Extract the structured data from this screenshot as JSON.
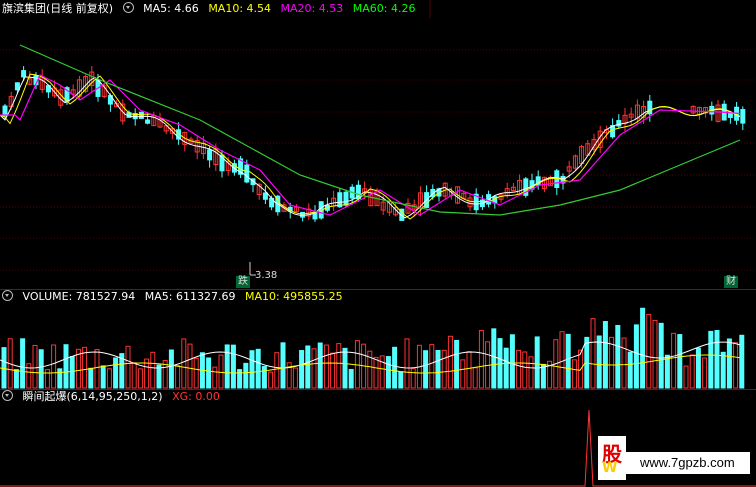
{
  "price_header": {
    "stock": "旗滨集团(日线 前复权)",
    "ma5": "MA5: 4.66",
    "ma10": "MA10: 4.54",
    "ma20": "MA20: 4.53",
    "ma60": "MA60: 4.26",
    "colors": {
      "stock": "#ffffff",
      "ma5": "#ffffff",
      "ma10": "#ffff00",
      "ma20": "#ff00ff",
      "ma60": "#00ff00"
    }
  },
  "price_low_label": "3.38",
  "tags": {
    "left": "跌",
    "right": "财"
  },
  "volume_header": {
    "volume": "VOLUME: 781527.94",
    "ma5": "MA5: 611327.69",
    "ma10": "MA10: 495855.25",
    "colors": {
      "volume": "#ffffff",
      "ma5": "#ffffff",
      "ma10": "#ffff00"
    }
  },
  "indicator_header": {
    "name": "瞬间起爆(6,14,95,250,1,2)",
    "xg": "XG: 0.00",
    "colors": {
      "name": "#ffffff",
      "xg": "#ff3333"
    }
  },
  "watermark": {
    "text": "www.7gpzb.com",
    "badge_top": "股",
    "badge_bottom": "W"
  },
  "chart_data": {
    "type": "candlestick",
    "series": [
      {
        "name": "MA5",
        "color": "#ffffff"
      },
      {
        "name": "MA10",
        "color": "#ffff00"
      },
      {
        "name": "MA20",
        "color": "#ff00ff"
      },
      {
        "name": "MA60",
        "color": "#00ff00"
      }
    ],
    "volume": {
      "last": 781527.94,
      "ma5": 611327.69,
      "ma10": 495855.25
    },
    "low_marker": 3.38
  }
}
